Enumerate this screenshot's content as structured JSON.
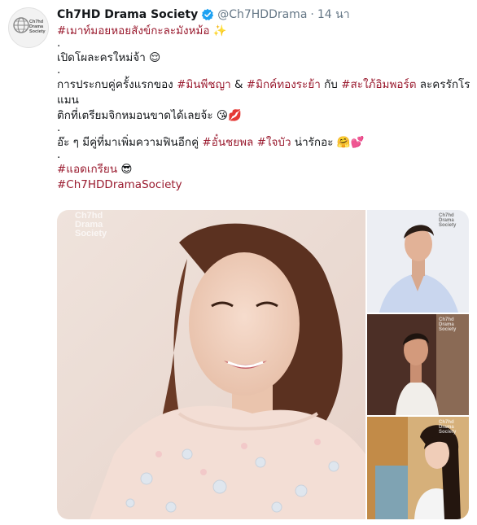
{
  "tweet": {
    "display_name": "Ch7HD Drama Society",
    "handle": "@Ch7HDDrama",
    "separator": "·",
    "time": "14 นา",
    "avatar_text": [
      "Ch7hd",
      "Drama",
      "Society"
    ]
  },
  "lines": {
    "l1_hashtag": "#เมาท์มอยหอยสังข์กะละมังหม้อ",
    "l1_emoji": "✨",
    "dot": ".",
    "l2_text": "เปิดโผละครใหม่จ้า",
    "l2_emoji": "😌",
    "l3_a": "การประกบคู่ครั้งแรกของ ",
    "l3_tag1": "#มินพีชญา",
    "l3_b": " & ",
    "l3_tag2": "#มิกค์ทองระย้า",
    "l3_c": " กับ ",
    "l3_tag3": "#สะใภ้อิมพอร์ต",
    "l3_d": " ละครรักโรแมน",
    "l4_text": "ติกที่เตรียมจิกหมอนขาดได้เลยจ้ะ",
    "l4_emoji": "😘💋",
    "l5_a": "อ๊ะ ๆ มีคู่ที่มาเพิ่มความฟินอีกคู่ ",
    "l5_tag": "#อั๋นชยพล",
    "l5_b": " ",
    "l5_tag2": "#ใจบัว",
    "l5_c": " น่ารักอะ",
    "l5_emoji": "🤗💕",
    "l6_tag": "#แอดเกรียน",
    "l6_emoji": "😎",
    "l7_tag": "#Ch7HDDramaSociety"
  },
  "media": {
    "watermark": [
      "Ch7hd",
      "Drama",
      "Society"
    ]
  },
  "colors": {
    "hashtag": "#9a1b2f",
    "handle": "#657786",
    "verified": "#1da1f2"
  }
}
